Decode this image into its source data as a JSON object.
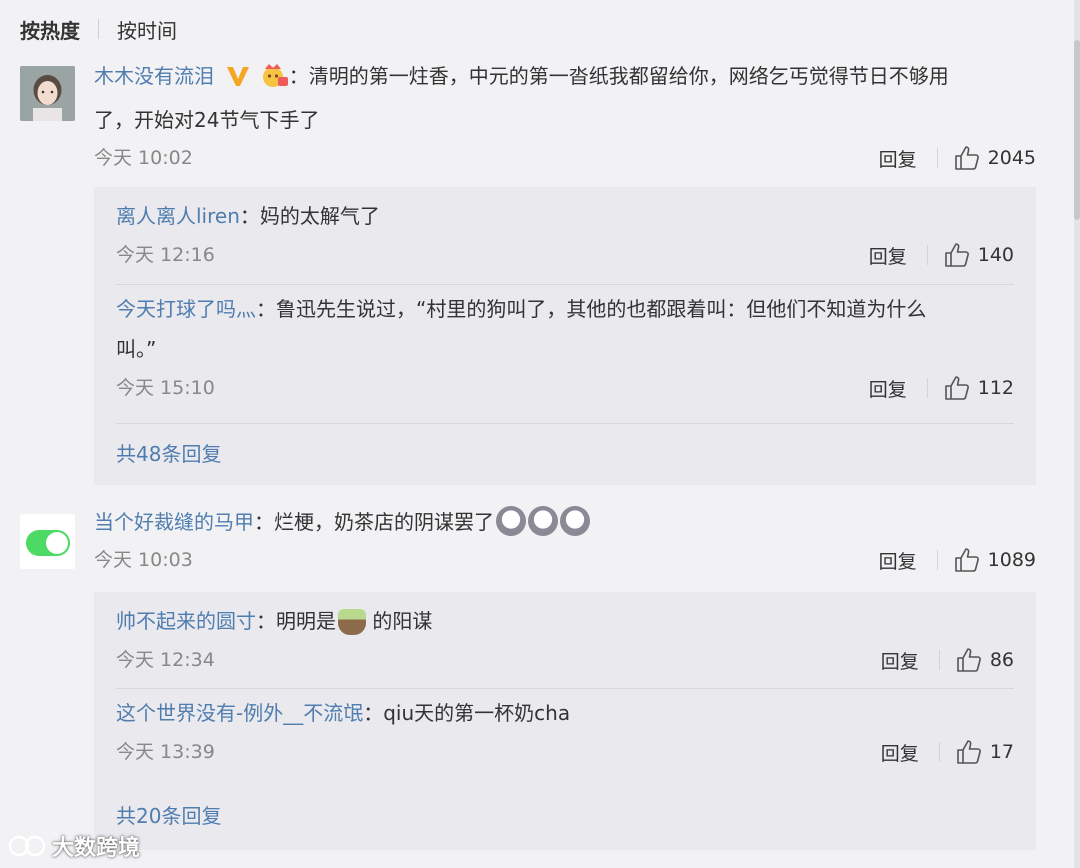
{
  "tabs": {
    "hot": "按热度",
    "time": "按时间"
  },
  "reply_label": "回复",
  "comments": [
    {
      "user": "木木没有流泪",
      "text_line1": "：清明的第一炷香，中元的第一沓纸我都留给你，网络乞丐觉得节日不够用",
      "text_line2": "了，开始对24节气下手了",
      "time": "今天 10:02",
      "likes": "2045",
      "replies": [
        {
          "user": "离人离人liren",
          "text": "：妈的太解气了",
          "time": "今天 12:16",
          "likes": "140"
        },
        {
          "user": "今天打球了吗灬",
          "text": "：鲁迅先生说过，“村里的狗叫了，其他的也都跟着叫：但他们不知道为什么",
          "text2": "叫。”",
          "time": "今天 15:10",
          "likes": "112"
        }
      ],
      "more": "共48条回复"
    },
    {
      "user": "当个好裁缝的马甲",
      "text": "：烂梗，奶茶店的阴谋罢了",
      "time": "今天 10:03",
      "likes": "1089",
      "replies": [
        {
          "user": "帅不起来的圆寸",
          "text_a": "：明明是",
          "text_b": " 的阳谋",
          "time": "今天 12:34",
          "likes": "86"
        },
        {
          "user": "这个世界没有-例外__不流氓",
          "text": "：qiu天的第一杯奶cha",
          "time": "今天 13:39",
          "likes": "17"
        }
      ],
      "more": "共20条回复"
    }
  ],
  "watermark": "大数跨境",
  "colors": {
    "link": "#507daf",
    "background": "#f2f2f5",
    "reply_box": "#e9e9ee",
    "badge": "#f5a623"
  },
  "icons": [
    "thumbs-up-icon",
    "verified-v-icon",
    "vip-crown-icon",
    "laugh-dog-emoji",
    "milk-tea-emoji",
    "toggle-switch-avatar"
  ]
}
